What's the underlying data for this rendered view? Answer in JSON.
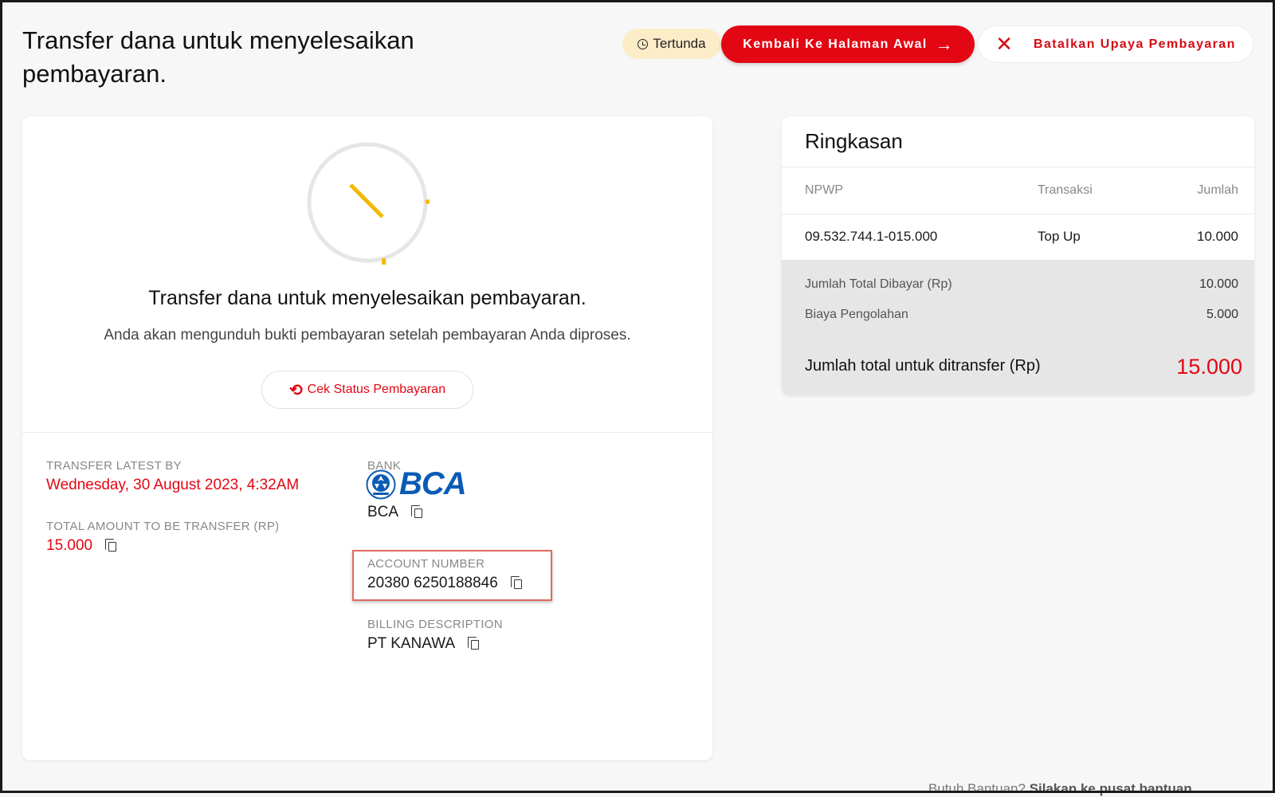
{
  "header": {
    "title": "Transfer dana untuk menyelesaikan pembayaran.",
    "status_badge": "Tertunda",
    "home_button": "Kembali Ke Halaman Awal",
    "cancel_button": "Batalkan Upaya Pembayaran"
  },
  "payment_card": {
    "heading": "Transfer dana untuk menyelesaikan pembayaran.",
    "subtext": "Anda akan mengunduh bukti pembayaran setelah pembayaran Anda diproses.",
    "check_status_button": "Cek Status Pembayaran",
    "transfer_latest_label": "TRANSFER LATEST BY",
    "transfer_latest_value": "Wednesday, 30 August 2023, 4:32AM",
    "total_amount_label": "TOTAL AMOUNT TO BE TRANSFER (RP)",
    "total_amount_value": "15.000",
    "bank_label": "BANK",
    "bank_logo_text": "BCA",
    "bank_value": "BCA",
    "account_number_label": "ACCOUNT NUMBER",
    "account_number_value": "20380 6250188846",
    "billing_description_label": "BILLING DESCRIPTION",
    "billing_description_value": "PT KANAWA"
  },
  "summary": {
    "title": "Ringkasan",
    "columns": [
      "NPWP",
      "Transaksi",
      "Jumlah"
    ],
    "rows": [
      {
        "npwp": "09.532.744.1-015.000",
        "transaction": "Top Up",
        "amount": "10.000"
      }
    ],
    "total_paid_label": "Jumlah Total Dibayar (Rp)",
    "total_paid_value": "10.000",
    "processing_fee_label": "Biaya Pengolahan",
    "processing_fee_value": "5.000",
    "grand_total_label": "Jumlah total untuk ditransfer (Rp)",
    "grand_total_value": "15.000"
  },
  "footer": {
    "help_prefix": "Butuh Bantuan?",
    "help_link": "Silakan ke pusat bantuan"
  },
  "colors": {
    "accent": "#e30613",
    "pending_badge": "#fdecc8",
    "spinner": "#f5b800",
    "bca_blue": "#0b5bb5"
  },
  "icons": {
    "status": "clock-icon",
    "home": "arrow-right-icon",
    "cancel": "close-icon",
    "check": "refresh-icon",
    "copy": "copy-icon"
  }
}
